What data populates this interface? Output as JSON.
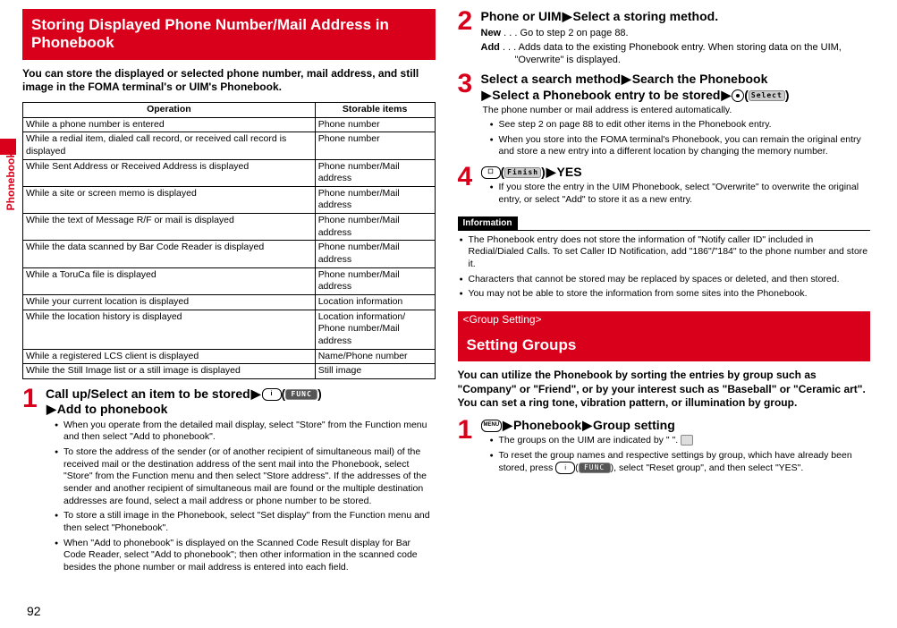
{
  "sidebar_label": "Phonebook",
  "page_number": "92",
  "left": {
    "heading": "Storing Displayed Phone Number/Mail Address in Phonebook",
    "intro": "You can store the displayed or selected phone number, mail address, and still image in the FOMA terminal's or UIM's Phonebook.",
    "table": {
      "head_op": "Operation",
      "head_store": "Storable items",
      "rows": [
        {
          "op": "While a phone number is entered",
          "store": "Phone number"
        },
        {
          "op": "While a redial item, dialed call record, or received call record is displayed",
          "store": "Phone number"
        },
        {
          "op": "While Sent Address or Received Address is displayed",
          "store": "Phone number/Mail address"
        },
        {
          "op": "While a site or screen memo is displayed",
          "store": "Phone number/Mail address"
        },
        {
          "op": "While the text of Message R/F or mail is displayed",
          "store": "Phone number/Mail address"
        },
        {
          "op": "While the data scanned by Bar Code Reader is displayed",
          "store": "Phone number/Mail address"
        },
        {
          "op": "While a ToruCa file is displayed",
          "store": "Phone number/Mail address"
        },
        {
          "op": "While your current location is displayed",
          "store": "Location information"
        },
        {
          "op": "While the location history is displayed",
          "store": "Location information/\nPhone number/Mail address"
        },
        {
          "op": "While a registered LCS client is displayed",
          "store": "Name/Phone number"
        },
        {
          "op": "While the Still Image list or a still image is displayed",
          "store": "Still image"
        }
      ]
    },
    "step1": {
      "num": "1",
      "title_a": "Call up/Select an item to be stored",
      "icon_label": "i",
      "pill": "FUNC",
      "title_b": "Add to phonebook",
      "notes": [
        "When you operate from the detailed mail display, select \"Store\" from the Function menu and then select \"Add to phonebook\".",
        "To store the address of the sender (or of another recipient of simultaneous mail) of the received mail or the destination address of the sent mail into the Phonebook, select \"Store\" from the Function menu and then select \"Store address\". If the addresses of the sender and another recipient of simultaneous mail are found or the multiple destination addresses are found, select a mail address or phone number to be stored.",
        "To store a still image in the Phonebook, select \"Set display\" from the Function menu and then select \"Phonebook\".",
        "When \"Add to phonebook\" is displayed on the Scanned Code Result display for Bar Code Reader, select \"Add to phonebook\"; then other information in the scanned code besides the phone number or mail address is entered into each field."
      ]
    }
  },
  "right": {
    "step2": {
      "num": "2",
      "title_a": "Phone or UIM",
      "title_b": "Select a storing method.",
      "defs": [
        {
          "term": "New",
          "dots": ". . .",
          "text": "Go to step 2 on page 88."
        },
        {
          "term": "Add",
          "dots": ". . .",
          "text": "Adds data to the existing Phonebook entry. When storing data on the UIM, \"Overwrite\" is displayed."
        }
      ]
    },
    "step3": {
      "num": "3",
      "line1_a": "Select a search method",
      "line1_b": "Search the Phonebook",
      "line2_a": "Select a Phonebook entry to be stored",
      "pill": "Select",
      "notes_pre": "The phone number or mail address is entered automatically.",
      "notes": [
        "See step 2 on page 88 to edit other items in the Phonebook entry.",
        "When you store into the FOMA terminal's Phonebook, you can remain the original entry and store a new entry into a different location by changing the memory number."
      ]
    },
    "step4": {
      "num": "4",
      "pill": "Finish",
      "yes": "YES",
      "notes": [
        "If you store the entry in the UIM Phonebook, select \"Overwrite\" to overwrite the original entry, or select \"Add\" to store it as a new entry."
      ]
    },
    "info": {
      "label": "Information",
      "items": [
        "The Phonebook entry does not store the information of \"Notify caller ID\" included in Redial/Dialed Calls. To set Caller ID Notification, add \"186\"/\"184\" to the phone number and store it.",
        "Characters that cannot be stored may be replaced by spaces or deleted, and then stored.",
        "You may not be able to store the information from some sites into the Phonebook."
      ]
    },
    "groups": {
      "sub": "<Group Setting>",
      "heading": "Setting Groups",
      "intro": "You can utilize the Phonebook by sorting the entries by group such as \"Company\" or \"Friend\", or by your interest such as \"Baseball\" or \"Ceramic art\". You can set a ring tone, vibration pattern, or illumination by group.",
      "step1": {
        "num": "1",
        "menu": "MENU",
        "title_a": "Phonebook",
        "title_b": "Group setting",
        "notes": [
          "The groups on the UIM are indicated by \"  \".",
          "To reset the group names and respective settings by group, which have already been stored, press (i)( FUNC ), select \"Reset group\", and then select \"YES\"."
        ],
        "note2_icon_a": "i",
        "note2_pill": "FUNC",
        "note2_tail": "select \"Reset group\", and then select \"YES\"."
      }
    }
  }
}
